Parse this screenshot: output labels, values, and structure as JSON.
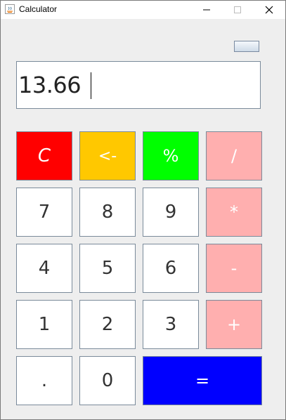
{
  "window": {
    "title": "Calculator"
  },
  "display": {
    "value": "13.66"
  },
  "keys": {
    "clear": "C",
    "backspace": "<-",
    "percent": "%",
    "divide": "/",
    "seven": "7",
    "eight": "8",
    "nine": "9",
    "multiply": "*",
    "four": "4",
    "five": "5",
    "six": "6",
    "subtract": "-",
    "one": "1",
    "two": "2",
    "three": "3",
    "add": "+",
    "decimal": ".",
    "zero": "0",
    "equals": "="
  },
  "colors": {
    "clear": "#ff0000",
    "backspace": "#ffc800",
    "percent": "#00ff00",
    "operator": "#ffafaf",
    "equals": "#0000ff"
  }
}
